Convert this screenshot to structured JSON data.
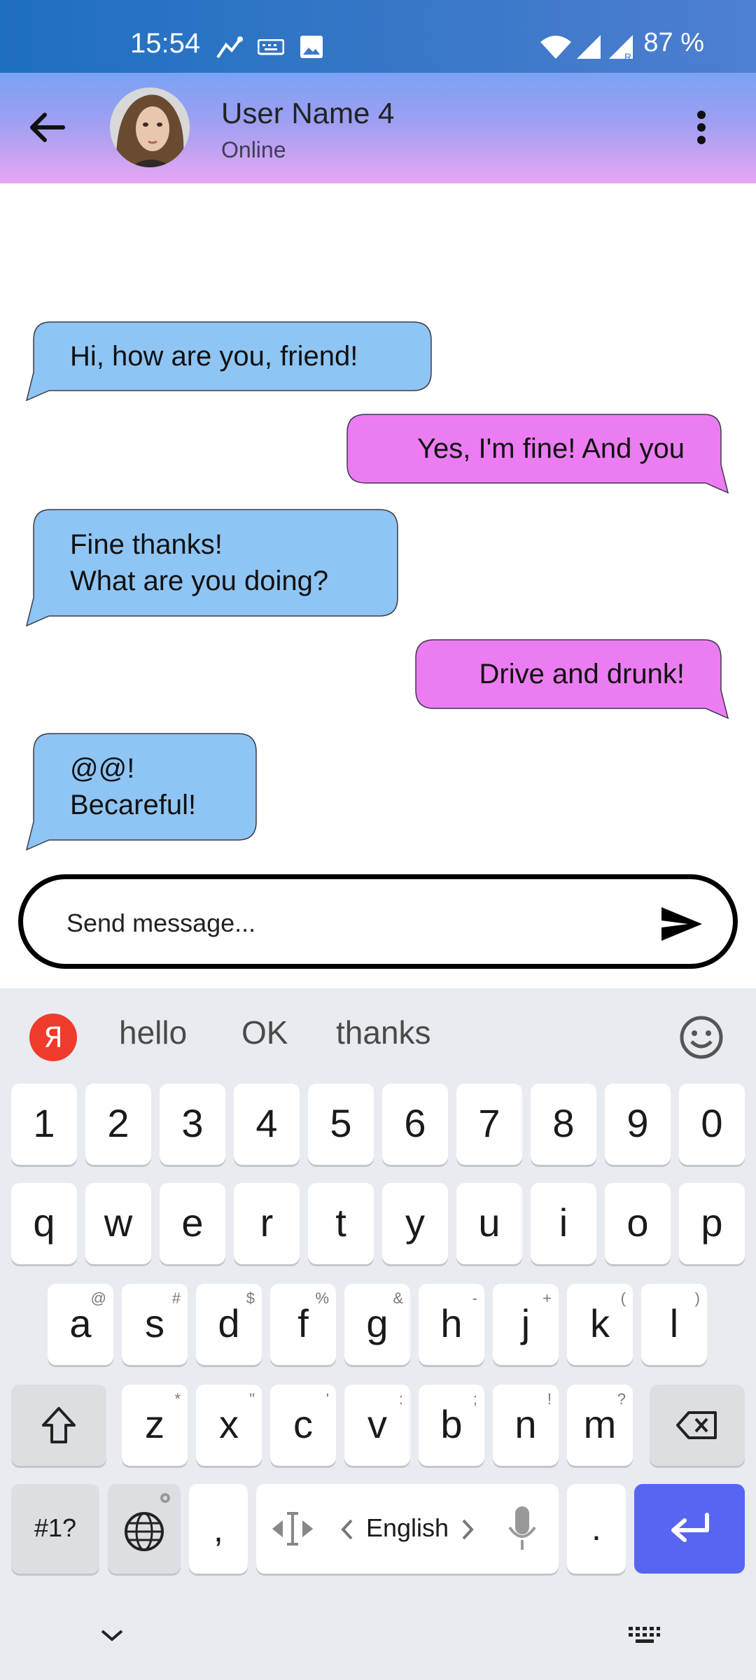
{
  "status_bar": {
    "time": "15:54",
    "battery": "87 %"
  },
  "header": {
    "user_name": "User Name 4",
    "status": "Online"
  },
  "messages": [
    {
      "side": "left",
      "text": "Hi, how are you, friend!"
    },
    {
      "side": "right",
      "text": "Yes, I'm fine! And you"
    },
    {
      "side": "left",
      "text": "Fine thanks!\nWhat are you doing?"
    },
    {
      "side": "right",
      "text": "Drive and drunk!"
    },
    {
      "side": "left",
      "text": "@@!\nBecareful!"
    }
  ],
  "composer": {
    "placeholder": "Send message..."
  },
  "keyboard": {
    "suggestions": [
      "hello",
      "OK",
      "thanks"
    ],
    "number_row": [
      "1",
      "2",
      "3",
      "4",
      "5",
      "6",
      "7",
      "8",
      "9",
      "0"
    ],
    "row1": [
      "q",
      "w",
      "e",
      "r",
      "t",
      "y",
      "u",
      "i",
      "o",
      "p"
    ],
    "row2": [
      "a",
      "s",
      "d",
      "f",
      "g",
      "h",
      "j",
      "k",
      "l"
    ],
    "row2_sup": [
      "@",
      "#",
      "$",
      "%",
      "&",
      "-",
      "+",
      "(",
      ")"
    ],
    "row3": [
      "z",
      "x",
      "c",
      "v",
      "b",
      "n",
      "m"
    ],
    "row3_sup": [
      "*",
      "\"",
      "'",
      ":",
      ";",
      "!",
      "?"
    ],
    "symbols_key": "#1?",
    "comma_key": ",",
    "space_label": "English",
    "period_key": "."
  },
  "colors": {
    "incoming": "#8ec5f4",
    "outgoing": "#ec7cf2",
    "enter": "#5865f2"
  }
}
